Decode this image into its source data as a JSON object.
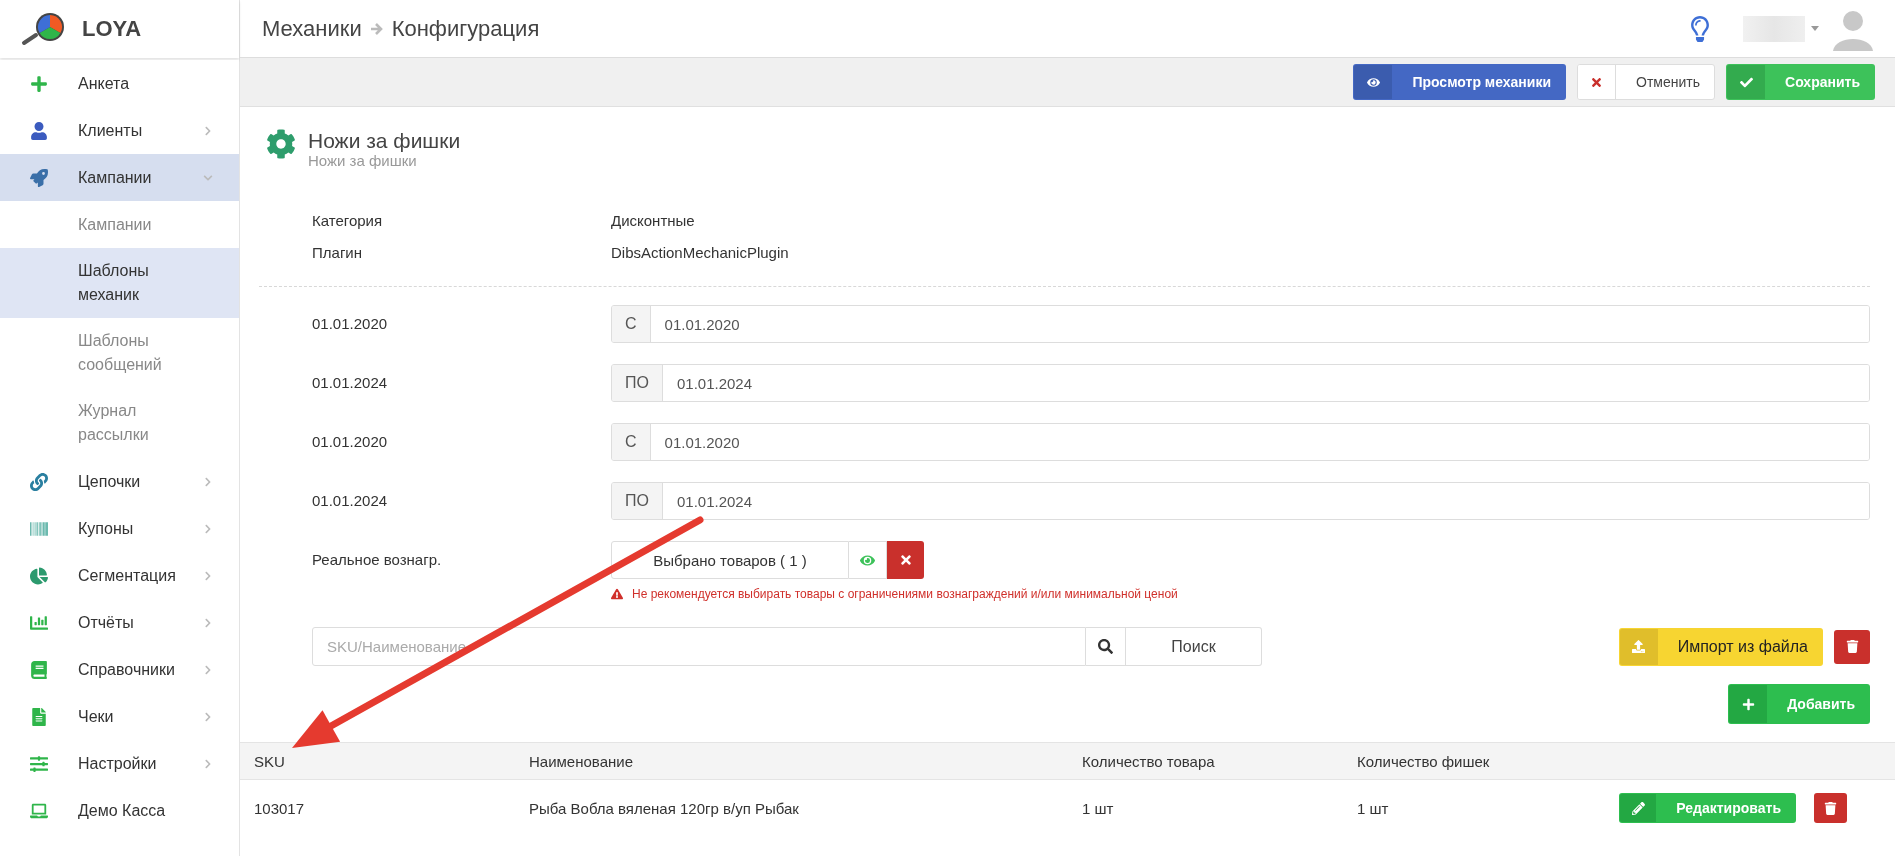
{
  "app": {
    "logo_text": "LOYA"
  },
  "breadcrumb": [
    "Механики",
    "Конфигурация"
  ],
  "sidebar": {
    "items": [
      {
        "label": "Анкета",
        "has_submenu": false,
        "selected": false
      },
      {
        "label": "Клиенты",
        "has_submenu": true,
        "expanded": false,
        "selected": false
      },
      {
        "label": "Кампании",
        "has_submenu": true,
        "expanded": true,
        "selected": true,
        "children": [
          {
            "label": "Кампании",
            "selected": false
          },
          {
            "label": "Шаблоны механик",
            "selected": true
          },
          {
            "label": "Шаблоны сообщений",
            "selected": false
          },
          {
            "label": "Журнал рассылки",
            "selected": false
          }
        ]
      },
      {
        "label": "Цепочки",
        "has_submenu": true,
        "expanded": false,
        "selected": false
      },
      {
        "label": "Купоны",
        "has_submenu": true,
        "expanded": false,
        "selected": false
      },
      {
        "label": "Сегментация",
        "has_submenu": true,
        "expanded": false,
        "selected": false
      },
      {
        "label": "Отчёты",
        "has_submenu": true,
        "expanded": false,
        "selected": false
      },
      {
        "label": "Справочники",
        "has_submenu": true,
        "expanded": false,
        "selected": false
      },
      {
        "label": "Чеки",
        "has_submenu": true,
        "expanded": false,
        "selected": false
      },
      {
        "label": "Настройки",
        "has_submenu": true,
        "expanded": false,
        "selected": false
      },
      {
        "label": "Демо Касса",
        "has_submenu": false,
        "selected": false
      }
    ]
  },
  "toolbar": {
    "buttons": [
      {
        "label": "Просмотр механики",
        "kind": "view"
      },
      {
        "label": "Отменить",
        "kind": "cancel"
      },
      {
        "label": "Сохранить",
        "kind": "save"
      }
    ]
  },
  "mechanic": {
    "title": "Ножи за фишки",
    "subtitle": "Ножи за фишки"
  },
  "info": [
    {
      "label": "Категория",
      "value": "Дисконтные"
    },
    {
      "label": "Плагин",
      "value": "DibsActionMechanicPlugin"
    }
  ],
  "dates": [
    {
      "label": "01.01.2020",
      "prefix": "С",
      "value": "01.01.2020"
    },
    {
      "label": "01.01.2024",
      "prefix": "ПО",
      "value": "01.01.2024"
    },
    {
      "label": "01.01.2020",
      "prefix": "С",
      "value": "01.01.2020"
    },
    {
      "label": "01.01.2024",
      "prefix": "ПО",
      "value": "01.01.2024"
    }
  ],
  "reward": {
    "label": "Реальное вознагр.",
    "button": "Выбрано товаров ( 1 )",
    "warning": "Не рекомендуется выбирать товары с ограничениями вознаграждений и/или минимальной ценой"
  },
  "search": {
    "placeholder": "SKU/Наименование",
    "button": "Поиск"
  },
  "import_button": "Импорт из файла",
  "add_button": "Добавить",
  "table": {
    "columns": [
      "SKU",
      "Наименование",
      "Количество товара",
      "Количество фишек"
    ],
    "rows": [
      {
        "cells": [
          "103017",
          "Рыба Вобла вяленая 120гр в/уп Рыбак",
          "1 шт",
          "1 шт"
        ],
        "edit_button": "Редактировать"
      }
    ]
  }
}
